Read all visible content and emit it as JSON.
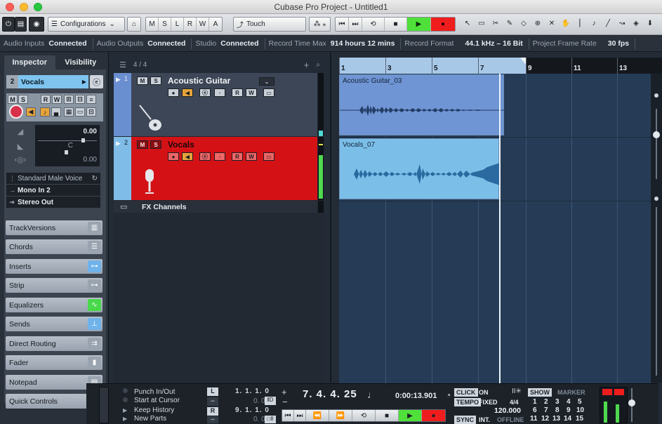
{
  "window": {
    "title": "Cubase Pro Project - Untitled1"
  },
  "toolbar": {
    "configurations_label": "Configurations",
    "mode_letters": [
      "M",
      "S",
      "L",
      "R",
      "W",
      "A"
    ],
    "automation_mode": "Touch",
    "transport_glyphs": [
      "⏮",
      "⏭",
      "⟲",
      "■",
      "▶",
      "●"
    ],
    "tool_glyphs": [
      "↖",
      "▭",
      "✂",
      "✎",
      "◇",
      "⊕",
      "✕",
      "✋",
      "⎮",
      "♪",
      "╱",
      "↝",
      "◈",
      "⬇"
    ]
  },
  "status": [
    {
      "label": "Audio Inputs",
      "value": "Connected"
    },
    {
      "label": "Audio Outputs",
      "value": "Connected"
    },
    {
      "label": "Studio",
      "value": "Connected"
    },
    {
      "label": "Record Time Max",
      "value": "914 hours 12 mins"
    },
    {
      "label": "Record Format",
      "value": "44.1 kHz – 16 Bit"
    },
    {
      "label": "Project Frame Rate",
      "value": "30 fps"
    }
  ],
  "inspector": {
    "tabs": {
      "inspector": "Inspector",
      "visibility": "Visibility"
    },
    "track_number": "2",
    "track_name": "Vocals",
    "volume_value": "0.00",
    "pan_value": "C",
    "send_value": "0.00",
    "preset": "Standard Male Voice",
    "input_routing": "Mono In 2",
    "output_routing": "Stereo Out",
    "sections": [
      {
        "label": "TrackVersions",
        "icon": "track-versions-icon",
        "color": "#9aa4b0"
      },
      {
        "label": "Chords",
        "icon": "chords-icon",
        "color": "#9aa4b0"
      },
      {
        "label": "Inserts",
        "icon": "inserts-icon",
        "color": "#6fb3ea"
      },
      {
        "label": "Strip",
        "icon": "strip-icon",
        "color": "#9aa4b0"
      },
      {
        "label": "Equalizers",
        "icon": "equalizers-icon",
        "color": "#49d84b"
      },
      {
        "label": "Sends",
        "icon": "sends-icon",
        "color": "#6fb3ea"
      },
      {
        "label": "Direct Routing",
        "icon": "direct-routing-icon",
        "color": "#9aa4b0"
      },
      {
        "label": "Fader",
        "icon": "fader-icon",
        "color": "#9aa4b0"
      },
      {
        "label": "Notepad",
        "icon": "notepad-icon",
        "color": "#9aa4b0"
      },
      {
        "label": "Quick Controls",
        "icon": "quick-controls-icon",
        "color": "#9aa4b0"
      }
    ]
  },
  "tracklist": {
    "count": "4 / 4",
    "tracks": [
      {
        "number": "1",
        "name": "Acoustic Guitar",
        "color": "#3d4656",
        "strip_color": "#6a8fd0",
        "icon": "guitar-icon"
      },
      {
        "number": "2",
        "name": "Vocals",
        "color": "#d41216",
        "strip_color": "#6a8fd0",
        "icon": "microphone-icon"
      }
    ],
    "fx_channels": "FX Channels"
  },
  "ruler": {
    "bars": [
      "1",
      "3",
      "5",
      "7",
      "9",
      "11",
      "13"
    ]
  },
  "events": [
    {
      "name": "Acoustic Guitar_03"
    },
    {
      "name": "Vocals_07"
    }
  ],
  "transport": {
    "punch_in_out": "Punch In/Out",
    "start_at_cursor": "Start at Cursor",
    "keep_history": "Keep History",
    "new_parts": "New Parts",
    "left_locator": "1. 1. 1.   0",
    "left_offset": "0.   0",
    "right_locator": "9. 1. 1.   0",
    "right_offset": "0.   0",
    "position_bars": "7. 4. 4. 25",
    "position_time": "0:00:13.901",
    "click_label": "CLICK",
    "click_state": "ON",
    "tempo_label": "TEMPO",
    "tempo_mode": "FIXED",
    "signature": "4/4",
    "tempo_value": "120.000",
    "sync_label": "SYNC",
    "sync_source": "INT.",
    "sync_state": "OFFLINE",
    "show_label": "SHOW",
    "marker_label": "MARKER",
    "markers": [
      "1",
      "2",
      "3",
      "4",
      "5",
      "6",
      "7",
      "8",
      "9",
      "10",
      "11",
      "12",
      "13",
      "14",
      "15"
    ]
  }
}
